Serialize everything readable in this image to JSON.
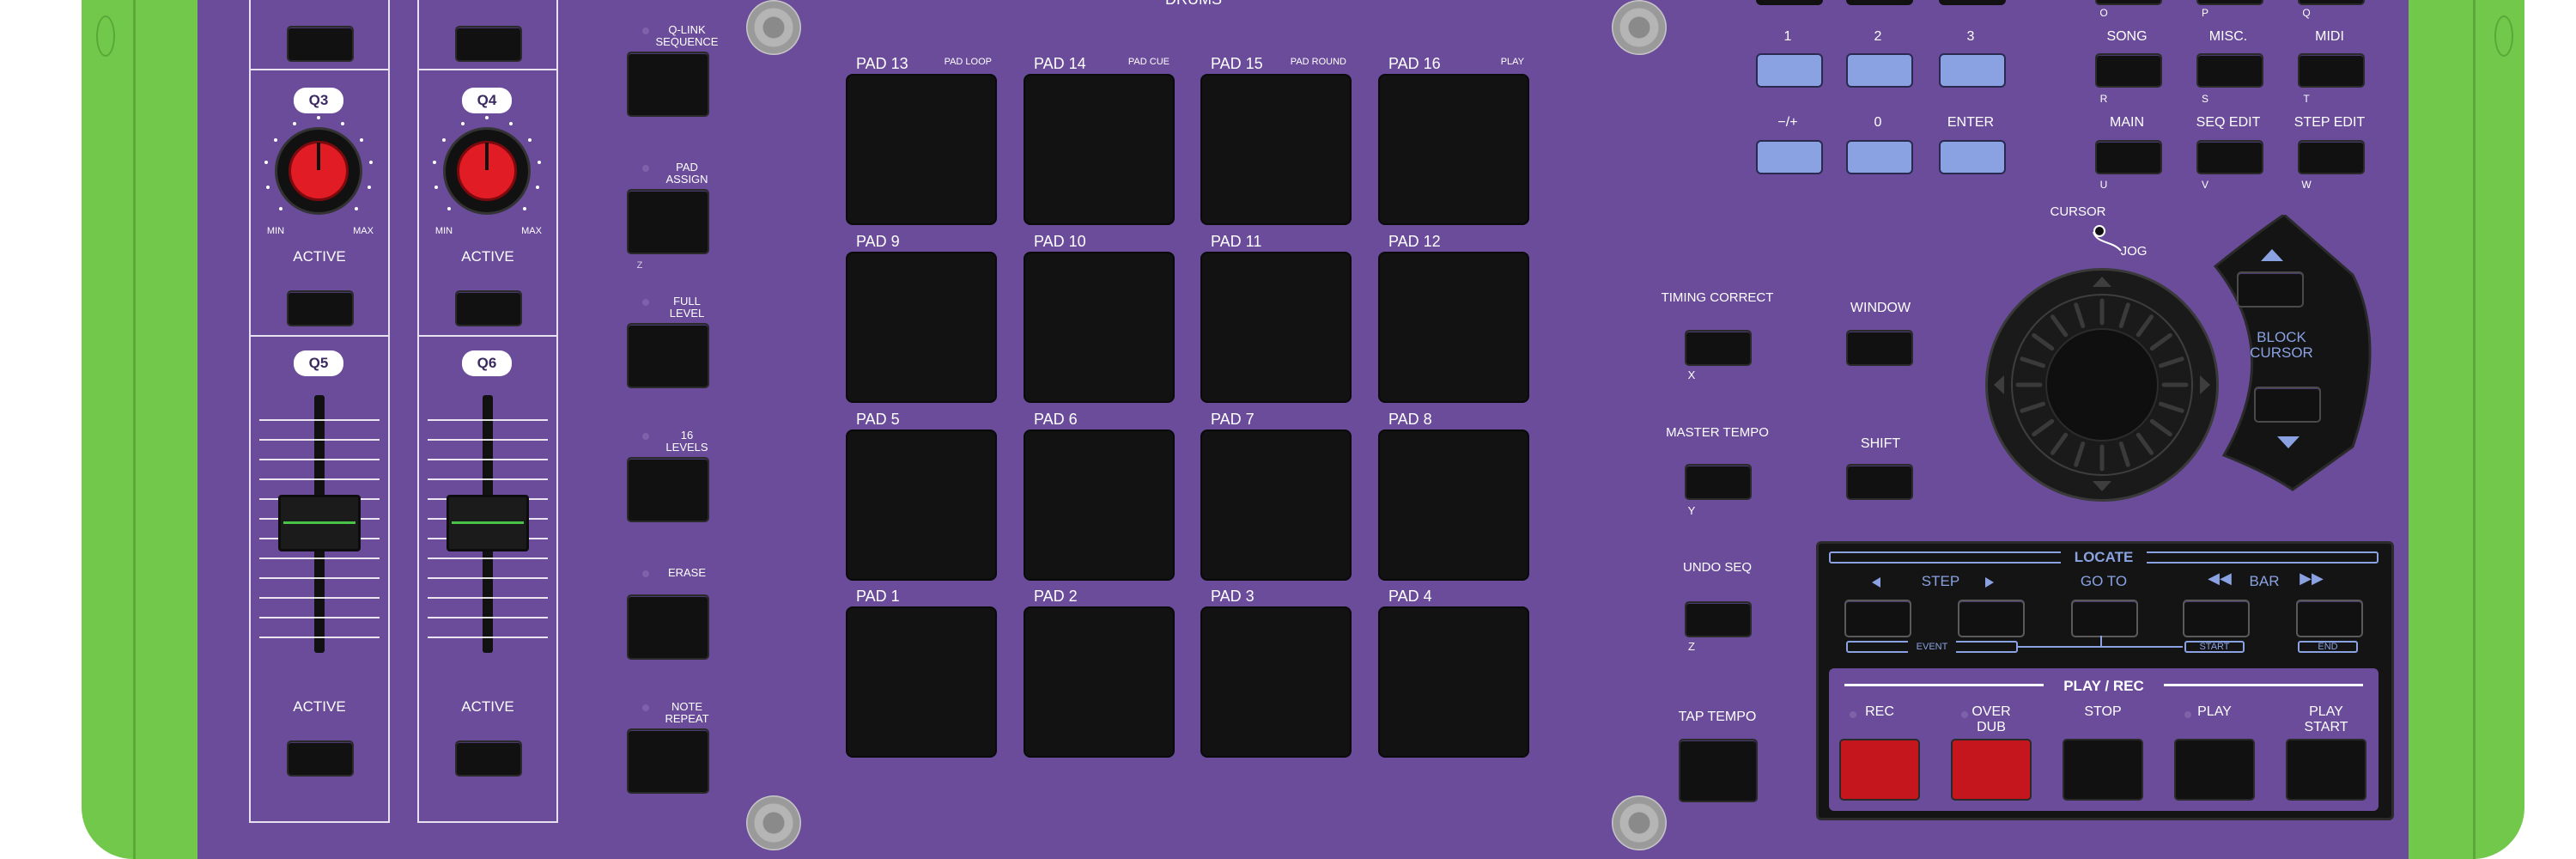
{
  "top": {
    "title": "DRUMS"
  },
  "left_strips": [
    {
      "knob_label": "Q3",
      "active_top": "ACTIVE",
      "min": "MIN",
      "max": "MAX",
      "fader_label": "Q5",
      "active_bottom": "ACTIVE"
    },
    {
      "knob_label": "Q4",
      "active_top": "ACTIVE",
      "min": "MIN",
      "max": "MAX",
      "fader_label": "Q6",
      "active_bottom": "ACTIVE"
    }
  ],
  "pad_buttons": [
    {
      "label": "Q-LINK\nSEQUENCE"
    },
    {
      "label": "PAD\nASSIGN",
      "sub": "Z"
    },
    {
      "label": "FULL\nLEVEL"
    },
    {
      "label": "16\nLEVELS"
    },
    {
      "label": "ERASE"
    },
    {
      "label": "NOTE\nREPEAT"
    }
  ],
  "pads": [
    [
      {
        "label": "PAD 13",
        "func": "PAD LOOP"
      },
      {
        "label": "PAD 14",
        "func": "PAD CUE"
      },
      {
        "label": "PAD 15",
        "func": "PAD ROUND"
      },
      {
        "label": "PAD 16",
        "func": "PLAY"
      }
    ],
    [
      {
        "label": "PAD 9",
        "func": ""
      },
      {
        "label": "PAD 10",
        "func": ""
      },
      {
        "label": "PAD 11",
        "func": ""
      },
      {
        "label": "PAD 12",
        "func": ""
      }
    ],
    [
      {
        "label": "PAD 5",
        "func": ""
      },
      {
        "label": "PAD 6",
        "func": ""
      },
      {
        "label": "PAD 7",
        "func": ""
      },
      {
        "label": "PAD 8",
        "func": ""
      }
    ],
    [
      {
        "label": "PAD 1",
        "func": ""
      },
      {
        "label": "PAD 2",
        "func": ""
      },
      {
        "label": "PAD 3",
        "func": ""
      },
      {
        "label": "PAD 4",
        "func": ""
      }
    ]
  ],
  "numpad": {
    "row1_top": [
      "O",
      "P",
      "Q"
    ],
    "row1": [
      "1",
      "2",
      "3"
    ],
    "row2": [
      "−/+",
      "0",
      "ENTER"
    ]
  },
  "modes": {
    "row1": [
      "SONG",
      "MISC.",
      "MIDI"
    ],
    "row1_sub": [
      "R",
      "S",
      "T"
    ],
    "row2": [
      "MAIN",
      "SEQ EDIT",
      "STEP EDIT"
    ],
    "row2_sub": [
      "U",
      "V",
      "W"
    ]
  },
  "cursor": {
    "label": "CURSOR",
    "jog": "JOG",
    "block": "BLOCK\nCURSOR"
  },
  "side_buttons": {
    "timing_correct": "TIMING CORRECT",
    "timing_sub": "X",
    "window": "WINDOW",
    "master_tempo": "MASTER TEMPO",
    "master_sub": "Y",
    "shift": "SHIFT",
    "undo_seq": "UNDO SEQ",
    "undo_sub": "Z",
    "tap_tempo": "TAP TEMPO"
  },
  "locate": {
    "title": "LOCATE",
    "step": "STEP",
    "goto": "GO TO",
    "bar": "BAR",
    "event": "EVENT",
    "start": "START",
    "end": "END"
  },
  "playrec": {
    "title": "PLAY / REC",
    "buttons": [
      "REC",
      "OVER\nDUB",
      "STOP",
      "PLAY",
      "PLAY\nSTART"
    ]
  },
  "colors": {
    "panel": "#6a4c9a",
    "body": "#71c84a",
    "rec": "#c4161c",
    "blue_button": "#8aa2e2"
  }
}
